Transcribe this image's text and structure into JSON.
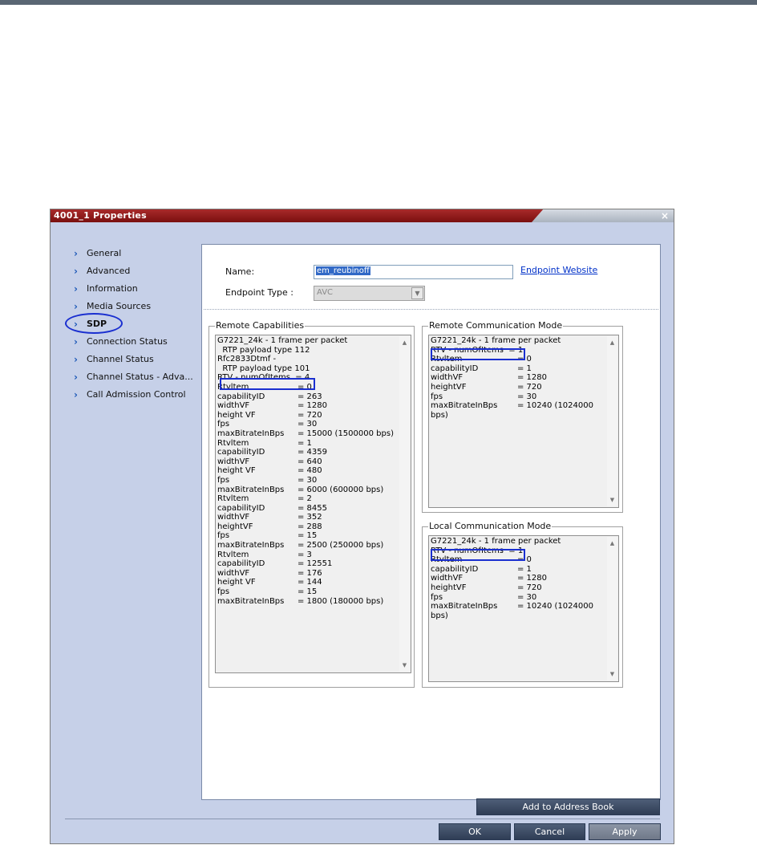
{
  "window": {
    "title": "4001_1 Properties",
    "close_label": "×"
  },
  "nav": {
    "items": [
      {
        "label": "General"
      },
      {
        "label": "Advanced"
      },
      {
        "label": "Information"
      },
      {
        "label": "Media Sources"
      },
      {
        "label": "SDP",
        "active": true
      },
      {
        "label": "Connection Status"
      },
      {
        "label": "Channel Status"
      },
      {
        "label": "Channel Status - Adva..."
      },
      {
        "label": "Call Admission Control"
      }
    ],
    "chevron": "›"
  },
  "form": {
    "name_label": "Name:",
    "name_value": "em_reubinoff",
    "website_link": "Endpoint Website",
    "type_label": "Endpoint Type :",
    "type_value": "AVC"
  },
  "remote_capabilities": {
    "title": "Remote Capabilities",
    "lines": [
      {
        "k": "G7221_24k - 1 frame per packet",
        "v": ""
      },
      {
        "k": "  RTP payload type 112",
        "v": ""
      },
      {
        "k": "Rfc2833Dtmf -",
        "v": ""
      },
      {
        "k": "  RTP payload type 101",
        "v": ""
      },
      {
        "k": "RTV - numOfItems  = 4",
        "v": ""
      },
      {
        "k": "Rtvltem",
        "v": "= 0"
      },
      {
        "k": "capabilityID",
        "v": "= 263"
      },
      {
        "k": "widthVF",
        "v": "= 1280"
      },
      {
        "k": "height VF",
        "v": "= 720"
      },
      {
        "k": "fps",
        "v": "= 30"
      },
      {
        "k": "maxBitrateInBps",
        "v": "= 15000 (1500000 bps)"
      },
      {
        "k": "Rtvltem",
        "v": "= 1"
      },
      {
        "k": "capabilityID",
        "v": "= 4359"
      },
      {
        "k": "widthVF",
        "v": "= 640"
      },
      {
        "k": "height VF",
        "v": "= 480"
      },
      {
        "k": "fps",
        "v": "= 30"
      },
      {
        "k": "maxBitrateInBps",
        "v": "= 6000 (600000 bps)"
      },
      {
        "k": "Rtvltem",
        "v": "= 2"
      },
      {
        "k": "capabilityID",
        "v": "= 8455"
      },
      {
        "k": "widthVF",
        "v": "= 352"
      },
      {
        "k": "heightVF",
        "v": "= 288"
      },
      {
        "k": "fps",
        "v": "= 15"
      },
      {
        "k": "maxBitrateInBps",
        "v": "= 2500 (250000 bps)"
      },
      {
        "k": "Rtvltem",
        "v": "= 3"
      },
      {
        "k": "capabilityID",
        "v": "= 12551"
      },
      {
        "k": "widthVF",
        "v": "= 176"
      },
      {
        "k": "height VF",
        "v": "= 144"
      },
      {
        "k": "fps",
        "v": "= 15"
      },
      {
        "k": "maxBitrateInBps",
        "v": "= 1800 (180000 bps)"
      }
    ]
  },
  "remote_comm_mode": {
    "title": "Remote Communication Mode",
    "lines": [
      {
        "k": "G7221_24k - 1 frame per packet",
        "v": ""
      },
      {
        "k": "RTV - numOfItems  = 1",
        "v": ""
      },
      {
        "k": "Rtvltem",
        "v": "= 0"
      },
      {
        "k": "capabilityID",
        "v": "= 1"
      },
      {
        "k": "widthVF",
        "v": "= 1280"
      },
      {
        "k": "heightVF",
        "v": "= 720"
      },
      {
        "k": "fps",
        "v": "= 30"
      },
      {
        "k": "maxBitrateInBps",
        "v": "= 10240 (1024000"
      },
      {
        "k": "bps)",
        "v": ""
      }
    ]
  },
  "local_comm_mode": {
    "title": "Local Communication Mode",
    "lines": [
      {
        "k": "G7221_24k - 1 frame per packet",
        "v": ""
      },
      {
        "k": "RTV - numOfItems  = 1",
        "v": ""
      },
      {
        "k": "Rtvltem",
        "v": "= 0"
      },
      {
        "k": "capabilityID",
        "v": "= 1"
      },
      {
        "k": "widthVF",
        "v": "= 1280"
      },
      {
        "k": "heightVF",
        "v": "= 720"
      },
      {
        "k": "fps",
        "v": "= 30"
      },
      {
        "k": "maxBitrateInBps",
        "v": "= 10240 (1024000"
      },
      {
        "k": "bps)",
        "v": ""
      }
    ]
  },
  "buttons": {
    "add_to_address_book": "Add to Address Book",
    "ok": "OK",
    "cancel": "Cancel",
    "apply": "Apply"
  },
  "scroll": {
    "up": "▲",
    "down": "▼"
  },
  "colors": {
    "title_bar": "#8f1b1b",
    "highlight": "#1a2fd0",
    "link": "#0030c8"
  }
}
